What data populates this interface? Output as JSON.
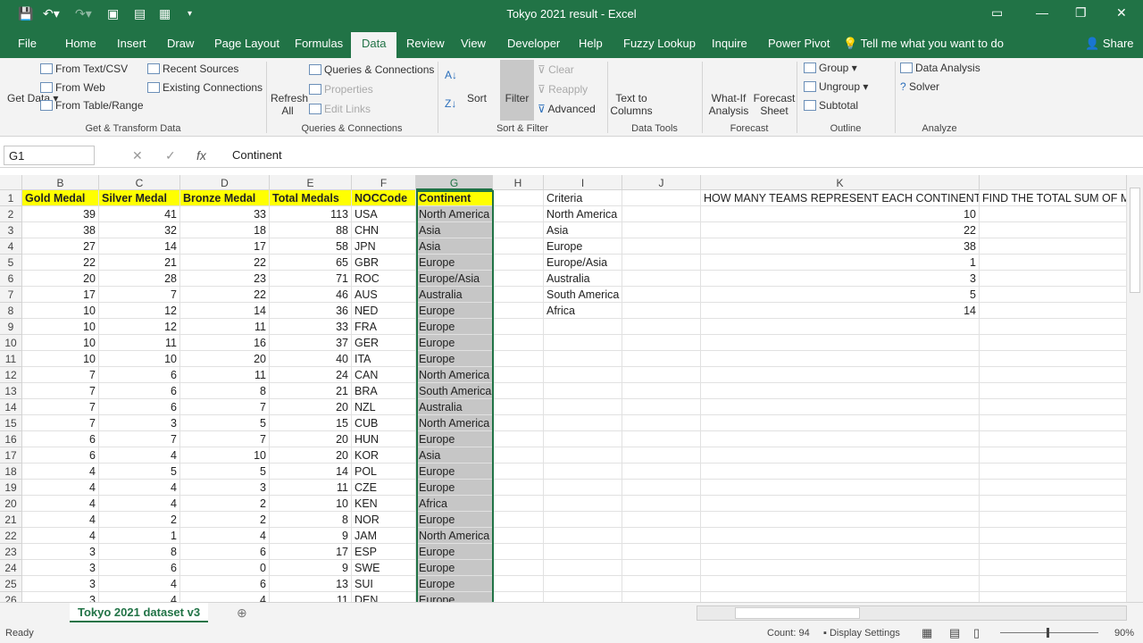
{
  "window": {
    "title": "Tokyo 2021 result  -  Excel"
  },
  "tabs": [
    "File",
    "Home",
    "Insert",
    "Draw",
    "Page Layout",
    "Formulas",
    "Data",
    "Review",
    "View",
    "Developer",
    "Help",
    "Fuzzy Lookup",
    "Inquire",
    "Power Pivot"
  ],
  "active_tab": "Data",
  "tell_me": "Tell me what you want to do",
  "share": "Share",
  "ribbon": {
    "get_data": "Get Data",
    "from_text": "From Text/CSV",
    "from_web": "From Web",
    "from_table": "From Table/Range",
    "recent_sources": "Recent Sources",
    "existing_connections": "Existing Connections",
    "group_get": "Get & Transform Data",
    "refresh_all": "Refresh All",
    "queries": "Queries & Connections",
    "properties": "Properties",
    "edit_links": "Edit Links",
    "group_queries": "Queries & Connections",
    "sort": "Sort",
    "filter": "Filter",
    "clear": "Clear",
    "reapply": "Reapply",
    "advanced": "Advanced",
    "group_sort": "Sort & Filter",
    "text_to_columns": "Text to Columns",
    "group_tools": "Data Tools",
    "what_if": "What-If Analysis",
    "forecast_sheet": "Forecast Sheet",
    "group_forecast": "Forecast",
    "group_btn": "Group",
    "ungroup": "Ungroup",
    "subtotal": "Subtotal",
    "group_outline": "Outline",
    "data_analysis": "Data Analysis",
    "solver": "Solver",
    "group_analyze": "Analyze"
  },
  "formula_bar": {
    "name_box": "G1",
    "value": "Continent"
  },
  "columns": [
    "B",
    "C",
    "D",
    "E",
    "F",
    "G",
    "H",
    "I",
    "J",
    "K",
    ""
  ],
  "headers": [
    "Gold Medal",
    "Silver Medal",
    "Bronze Medal",
    "Total Medals",
    "NOCCode",
    "Continent"
  ],
  "rows": [
    [
      39,
      41,
      33,
      113,
      "USA",
      "North America"
    ],
    [
      38,
      32,
      18,
      88,
      "CHN",
      "Asia"
    ],
    [
      27,
      14,
      17,
      58,
      "JPN",
      "Asia"
    ],
    [
      22,
      21,
      22,
      65,
      "GBR",
      "Europe"
    ],
    [
      20,
      28,
      23,
      71,
      "ROC",
      "Europe/Asia"
    ],
    [
      17,
      7,
      22,
      46,
      "AUS",
      "Australia"
    ],
    [
      10,
      12,
      14,
      36,
      "NED",
      "Europe"
    ],
    [
      10,
      12,
      11,
      33,
      "FRA",
      "Europe"
    ],
    [
      10,
      11,
      16,
      37,
      "GER",
      "Europe"
    ],
    [
      10,
      10,
      20,
      40,
      "ITA",
      "Europe"
    ],
    [
      7,
      6,
      11,
      24,
      "CAN",
      "North America"
    ],
    [
      7,
      6,
      8,
      21,
      "BRA",
      "South America"
    ],
    [
      7,
      6,
      7,
      20,
      "NZL",
      "Australia"
    ],
    [
      7,
      3,
      5,
      15,
      "CUB",
      "North America"
    ],
    [
      6,
      7,
      7,
      20,
      "HUN",
      "Europe"
    ],
    [
      6,
      4,
      10,
      20,
      "KOR",
      "Asia"
    ],
    [
      4,
      5,
      5,
      14,
      "POL",
      "Europe"
    ],
    [
      4,
      4,
      3,
      11,
      "CZE",
      "Europe"
    ],
    [
      4,
      4,
      2,
      10,
      "KEN",
      "Africa"
    ],
    [
      4,
      2,
      2,
      8,
      "NOR",
      "Europe"
    ],
    [
      4,
      1,
      4,
      9,
      "JAM",
      "North America"
    ],
    [
      3,
      8,
      6,
      17,
      "ESP",
      "Europe"
    ],
    [
      3,
      6,
      0,
      9,
      "SWE",
      "Europe"
    ],
    [
      3,
      4,
      6,
      13,
      "SUI",
      "Europe"
    ],
    [
      3,
      4,
      4,
      11,
      "DEN",
      "Europe"
    ]
  ],
  "criteria": {
    "header": "Criteria",
    "k_header": "HOW MANY TEAMS REPRESENT EACH CONTINENT",
    "l_header": "FIND THE TOTAL SUM OF MEDALS",
    "items": [
      [
        "North America",
        10
      ],
      [
        "Asia",
        22
      ],
      [
        "Europe",
        38
      ],
      [
        "Europe/Asia",
        1
      ],
      [
        "Australia",
        3
      ],
      [
        "South America",
        5
      ],
      [
        "Africa",
        14
      ]
    ]
  },
  "sheet_tab": "Tokyo 2021 dataset v3",
  "status": {
    "ready": "Ready",
    "count": "Count: 94",
    "display_settings": "Display Settings",
    "zoom": "90%"
  },
  "colors": {
    "accent": "#217346",
    "header_fill": "#ffff00"
  }
}
